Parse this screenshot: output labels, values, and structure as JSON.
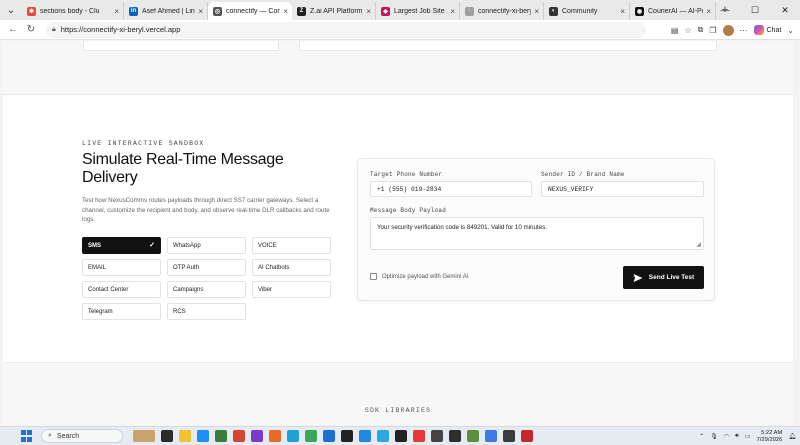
{
  "browser": {
    "tabs": [
      {
        "title": "sections body - Clu",
        "favicon_color": "#e64a3c",
        "favicon_glyph": "✱",
        "active": false
      },
      {
        "title": "Asef Ahmed | Linke",
        "favicon_color": "#0a66c2",
        "favicon_glyph": "in",
        "active": false
      },
      {
        "title": "connectify — Com",
        "favicon_color": "#555555",
        "favicon_glyph": "◎",
        "active": true
      },
      {
        "title": "Z.ai API Platform —",
        "favicon_color": "#222222",
        "favicon_glyph": "Z",
        "active": false
      },
      {
        "title": "Largest Job Site in",
        "favicon_color": "#c2185b",
        "favicon_glyph": "◆",
        "active": false
      },
      {
        "title": "connectify-xi-beryl",
        "favicon_color": "#9e9e9e",
        "favicon_glyph": "◌",
        "active": false
      },
      {
        "title": "Community",
        "favicon_color": "#333333",
        "favicon_glyph": "◐",
        "active": false
      },
      {
        "title": "CourierAI — AI-Po",
        "favicon_color": "#111111",
        "favicon_glyph": "◉",
        "active": false
      }
    ],
    "url": "https://connectify-xi-beryl.vercel.app",
    "chat_label": "Chat"
  },
  "sandbox": {
    "eyebrow": "LIVE INTERACTIVE SANDBOX",
    "headline": "Simulate Real-Time Message Delivery",
    "description": "Test how NexusComms routes payloads through direct SS7 carrier gateways. Select a channel, customize the recipient and body, and observe real-time DLR callbacks and route logs.",
    "channels": [
      {
        "label": "SMS",
        "selected": true
      },
      {
        "label": "WhatsApp",
        "selected": false
      },
      {
        "label": "VOICE",
        "selected": false
      },
      {
        "label": "EMAIL",
        "selected": false
      },
      {
        "label": "OTP Auth",
        "selected": false
      },
      {
        "label": "AI Chatbots",
        "selected": false
      },
      {
        "label": "Contact Center",
        "selected": false
      },
      {
        "label": "Campaigns",
        "selected": false
      },
      {
        "label": "Viber",
        "selected": false
      },
      {
        "label": "Telegram",
        "selected": false
      },
      {
        "label": "RCS",
        "selected": false
      }
    ],
    "form": {
      "phone_label": "Target Phone Number",
      "phone_value": "+1 (555) 019-2834",
      "sender_label": "Sender ID / Brand Name",
      "sender_value": "NEXUS_VERIFY",
      "body_label": "Message Body Payload",
      "body_value": "Your security verification code is 849201. Valid for 10 minutes.",
      "optimize_label": "Optimize payload with Gemini AI",
      "send_label": "Send Live Test"
    }
  },
  "sdk": {
    "label": "SDK LIBRARIES"
  },
  "taskbar": {
    "search_placeholder": "Search",
    "time": "5:22 AM",
    "date": "7/29/2026"
  }
}
